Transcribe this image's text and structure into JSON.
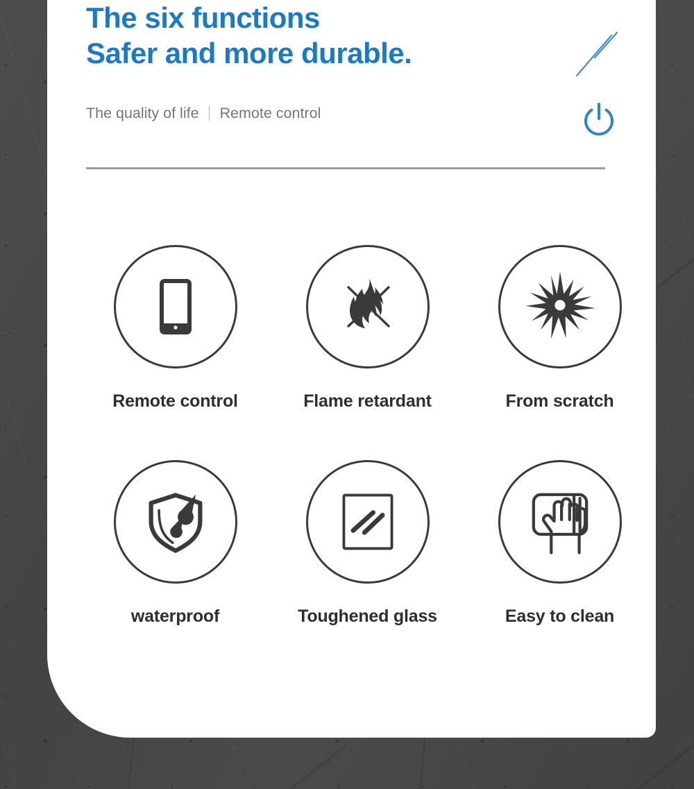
{
  "card": {
    "headline_line1": "The six functions",
    "headline_line2": "Safer and more durable.",
    "subtitle_left": "The quality of life",
    "subtitle_right": "Remote control",
    "accent_color": "#1a7ac6",
    "text_color": "#2e2e2e",
    "subtitle_color": "#757575",
    "icon_stroke_color": "#3a3a3a",
    "background_color": "#474747",
    "card_color": "#ffffff"
  },
  "decorations": [
    {
      "name": "shine-lines",
      "color": "#3f8fd0"
    },
    {
      "name": "power-button",
      "color": "#2f86cc"
    }
  ],
  "features": [
    {
      "label": "Remote control",
      "icon": "smartphone-icon"
    },
    {
      "label": "Flame retardant",
      "icon": "no-flame-icon"
    },
    {
      "label": "From scratch",
      "icon": "impact-burst-icon"
    },
    {
      "label": "waterproof",
      "icon": "shield-droplet-icon"
    },
    {
      "label": "Toughened glass",
      "icon": "glass-panel-icon"
    },
    {
      "label": "Easy to clean",
      "icon": "hand-wipe-icon"
    }
  ]
}
